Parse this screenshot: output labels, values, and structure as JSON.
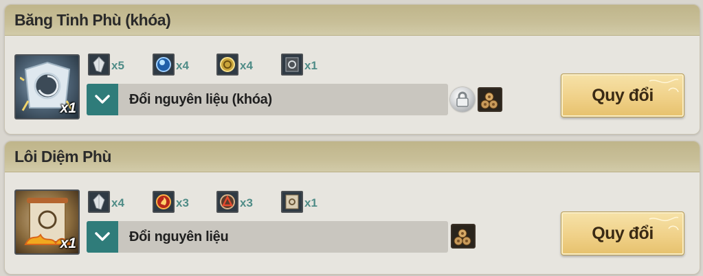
{
  "recipes": [
    {
      "title": "Băng Tinh Phù (khóa)",
      "result_qty": "x1",
      "result_icon": "ice-talisman-icon",
      "materials": [
        {
          "icon": "crystal-shard-icon",
          "qty": "x5"
        },
        {
          "icon": "blue-orb-icon",
          "qty": "x4"
        },
        {
          "icon": "gold-emblem-icon",
          "qty": "x4"
        },
        {
          "icon": "dark-scroll-icon",
          "qty": "x1"
        }
      ],
      "dropdown_label": "Đổi nguyên liệu (khóa)",
      "show_lock": true,
      "button_label": "Quy đổi"
    },
    {
      "title": "Lôi Diệm Phù",
      "result_qty": "x1",
      "result_icon": "fire-talisman-icon",
      "materials": [
        {
          "icon": "crystal-shard-icon",
          "qty": "x4"
        },
        {
          "icon": "fire-orb-icon",
          "qty": "x3"
        },
        {
          "icon": "flame-emblem-icon",
          "qty": "x3"
        },
        {
          "icon": "paper-scroll-icon",
          "qty": "x1"
        }
      ],
      "dropdown_label": "Đổi nguyên liệu",
      "show_lock": false,
      "button_label": "Quy đổi"
    }
  ],
  "colors": {
    "accent_teal": "#2f7c7a",
    "qty_teal": "#4f8c87",
    "header_tan": "#c8bf98",
    "button_gold": "#f0d189"
  }
}
